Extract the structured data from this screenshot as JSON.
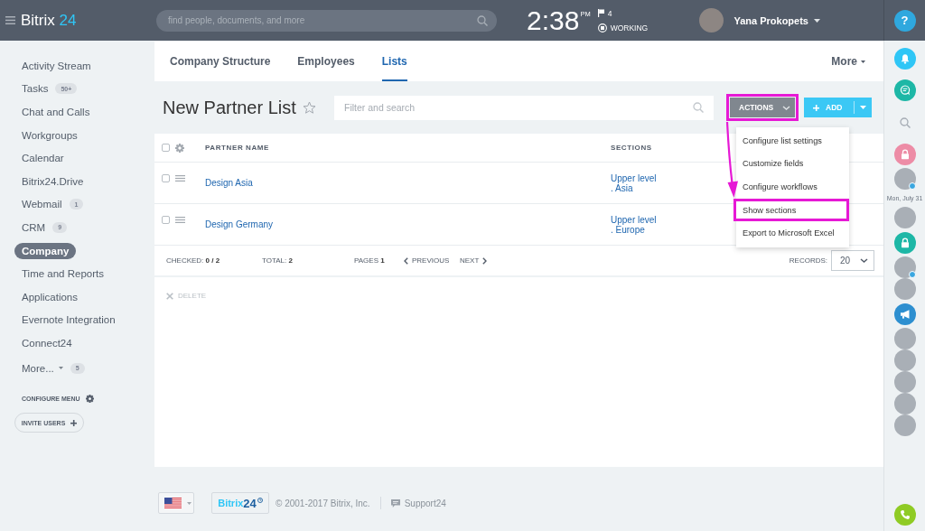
{
  "header": {
    "logo": {
      "text": "Bitrix",
      "accent": "24"
    },
    "search_placeholder": "find people, documents, and more",
    "clock": {
      "time": "2:38",
      "period": "PM"
    },
    "flags": "4",
    "work_status": "WORKING",
    "user_name": "Yana Prokopets",
    "help": "?"
  },
  "sidebar": {
    "items": [
      {
        "label": "Activity Stream",
        "selected": false
      },
      {
        "label": "Tasks",
        "count": "50+",
        "selected": false
      },
      {
        "label": "Chat and Calls",
        "selected": false
      },
      {
        "label": "Workgroups",
        "selected": false
      },
      {
        "label": "Calendar",
        "selected": false
      },
      {
        "label": "Bitrix24.Drive",
        "selected": false
      },
      {
        "label": "Webmail",
        "count": "1",
        "selected": false
      },
      {
        "label": "CRM",
        "count": "9",
        "selected": false
      },
      {
        "label": "Company",
        "selected": true
      },
      {
        "label": "Time and Reports",
        "selected": false
      },
      {
        "label": "Applications",
        "selected": false
      },
      {
        "label": "Evernote Integration",
        "selected": false
      },
      {
        "label": "Connect24",
        "selected": false
      }
    ],
    "more": {
      "label": "More...",
      "count": "5"
    },
    "configure_menu": "CONFIGURE MENU",
    "invite_users": "INVITE USERS"
  },
  "tabs": {
    "items": [
      {
        "label": "Company Structure",
        "selected": false
      },
      {
        "label": "Employees",
        "selected": false
      },
      {
        "label": "Lists",
        "selected": true
      }
    ],
    "more": "More"
  },
  "title_bar": {
    "title": "New Partner List",
    "filter_placeholder": "Filter and search",
    "actions": {
      "label": "ACTIONS",
      "highlighted": true
    },
    "add": {
      "label": "ADD",
      "highlighted": false
    }
  },
  "actions_menu": {
    "items": [
      {
        "label": "Configure list settings",
        "highlighted": false
      },
      {
        "label": "Customize fields",
        "highlighted": false
      },
      {
        "label": "Configure workflows",
        "highlighted": false
      },
      {
        "label": "Show sections",
        "highlighted": true
      },
      {
        "label": "Export to Microsoft Excel",
        "highlighted": false
      }
    ]
  },
  "table": {
    "header_checked": false,
    "columns": [
      "PARTNER NAME",
      "SECTIONS"
    ],
    "rows": [
      {
        "checked": false,
        "name": "Design Asia",
        "sections": [
          "Upper level",
          ". Asia"
        ]
      },
      {
        "checked": false,
        "name": "Design Germany",
        "sections": [
          "Upper level",
          ". Europe"
        ]
      }
    ],
    "pager": {
      "checked": "CHECKED: **0 / 2**",
      "total": "TOTAL: **2**",
      "pages": "PAGES **1**",
      "previous": "PREVIOUS",
      "next": "NEXT",
      "records_label": "RECORDS:",
      "records_value": "20"
    },
    "delete": {
      "label": "DELETE",
      "disabled": true
    }
  },
  "right_panel": [
    {
      "kind": "bell",
      "color": "#2fc6f6"
    },
    {
      "kind": "chat",
      "color": "#1db7a6"
    },
    {
      "kind": "search"
    },
    {
      "kind": "lock",
      "color": "#ed8ca6"
    },
    {
      "kind": "avatar",
      "badge": true
    },
    {
      "kind": "date",
      "text": "Mon, July 31"
    },
    {
      "kind": "avatar",
      "badge": false
    },
    {
      "kind": "lock",
      "color": "#1db7a6"
    },
    {
      "kind": "avatar",
      "badge": true
    },
    {
      "kind": "avatar",
      "badge": false
    },
    {
      "kind": "megaphone",
      "color": "#2d8fd0"
    },
    {
      "kind": "avatar",
      "badge": false
    },
    {
      "kind": "avatar",
      "badge": false
    },
    {
      "kind": "avatar",
      "badge": false
    },
    {
      "kind": "avatar",
      "badge": false
    },
    {
      "kind": "avatar",
      "badge": false
    },
    {
      "kind": "phone",
      "color": "#8fcb24"
    }
  ],
  "footer": {
    "logo": {
      "text": "Bitrix",
      "accent": "24"
    },
    "copyright": "© 2001-2017 Bitrix, Inc.",
    "support": "Support24"
  }
}
